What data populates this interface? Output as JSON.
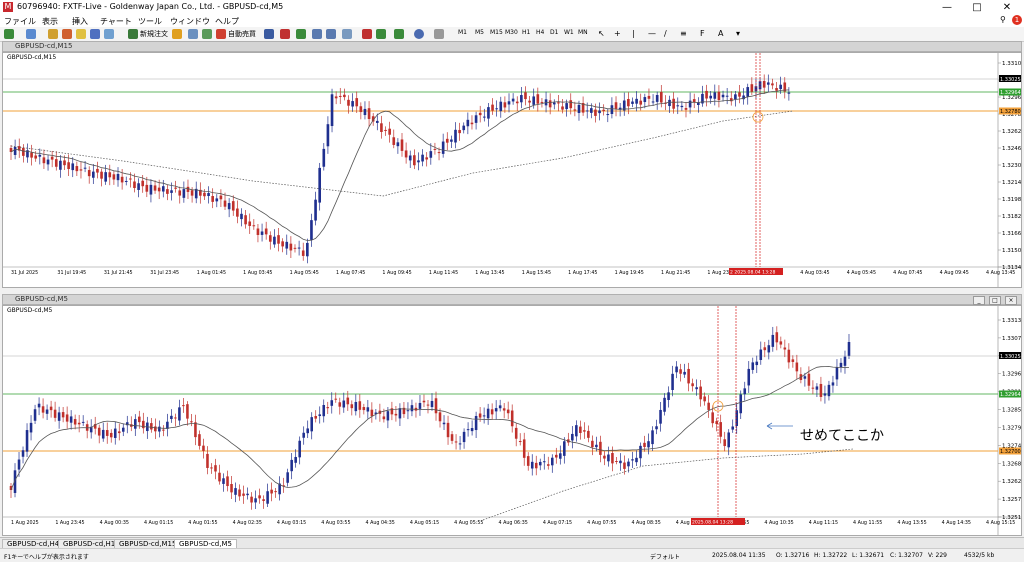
{
  "window": {
    "title": "60796940: FXTF-Live - Goldenway Japan Co., Ltd. - GBPUSD-cd,M5"
  },
  "menu": [
    "ファイル",
    "表示",
    "挿入",
    "チャート",
    "ツール",
    "ウィンドウ",
    "ヘルプ"
  ],
  "toolbar": {
    "new_order": "新規注文",
    "auto_trade": "自動売買",
    "timeframes": [
      "M1",
      "M5",
      "M15",
      "M30",
      "H1",
      "H4",
      "D1",
      "W1",
      "MN"
    ]
  },
  "colors": {
    "bull": "#1f2f8f",
    "bear": "#c0302b",
    "sma": "#555555",
    "support": "#f2a03a",
    "resist": "#2f9f2f",
    "marker": "#d42020"
  },
  "top_chart": {
    "caption": "GBPUSD-cd,M15",
    "label": "GBPUSD-cd,M15",
    "price_labels": [
      "1.33100",
      "1.33025",
      "1.32964",
      "1.32780",
      "1.32620",
      "1.32460",
      "1.32300",
      "1.32140",
      "1.31980",
      "1.31820",
      "1.31660",
      "1.31500",
      "1.31340"
    ],
    "time_labels": [
      "31 Jul 2025",
      "31 Jul 19:45",
      "31 Jul 21:45",
      "31 Jul 23:45",
      "1 Aug 01:45",
      "1 Aug 03:45",
      "1 Aug 05:45",
      "1 Aug 07:45",
      "1 Aug 09:45",
      "1 Aug 11:45",
      "1 Aug 13:45",
      "1 Aug 15:45",
      "1 Aug 17:45",
      "1 Aug 19:45",
      "1 Aug 21:45",
      "1 Aug 23:45",
      "4 Aug 01:45",
      "4 Aug 03:45",
      "4 Aug 05:45",
      "4 Aug 07:45",
      "4 Aug 09:45",
      "4 Aug 13:45"
    ],
    "marker_time": "2 2025.08.04 13:28",
    "current_price": "1.33025",
    "green_price": "1.32964",
    "orange_price": "1.32780"
  },
  "bottom_chart": {
    "caption": "GBPUSD-cd,M5",
    "label": "GBPUSD-cd,M5",
    "price_labels": [
      "1.33130",
      "1.33075",
      "1.33025",
      "1.32965",
      "1.32910",
      "1.32850",
      "1.32795",
      "1.32740",
      "1.32680",
      "1.32625",
      "1.32570",
      "1.32515"
    ],
    "time_labels": [
      "1 Aug 2025",
      "1 Aug 23:45",
      "4 Aug 00:35",
      "4 Aug 01:15",
      "4 Aug 01:55",
      "4 Aug 02:35",
      "4 Aug 03:15",
      "4 Aug 03:55",
      "4 Aug 04:35",
      "4 Aug 05:15",
      "4 Aug 05:55",
      "4 Aug 06:35",
      "4 Aug 07:15",
      "4 Aug 07:55",
      "4 Aug 08:35",
      "4 Aug 09:15",
      "4 Aug 09:55",
      "4 Aug 10:35",
      "4 Aug 11:15",
      "4 Aug 11:55",
      "4 Aug 13:55",
      "4 Aug 14:35",
      "4 Aug 15:15"
    ],
    "marker_time": "2025.08.04 13:28",
    "current_price": "1.33025",
    "green_price": "1.32964",
    "orange_price": "1.32700",
    "annotation": "せめてここか"
  },
  "tabs": [
    "GBPUSD-cd,H4",
    "GBPUSD-cd,H1",
    "GBPUSD-cd,M15",
    "GBPUSD-cd,M5"
  ],
  "active_tab": 3,
  "status": {
    "help": "F1キーでヘルプが表示されます",
    "profile": "デフォルト",
    "datetime": "2025.08.04 11:35",
    "open": "O: 1.32716",
    "high": "H: 1.32722",
    "low": "L: 1.32671",
    "close": "C: 1.32707",
    "volume": "V: 229",
    "traffic": "4532/5 kb"
  }
}
